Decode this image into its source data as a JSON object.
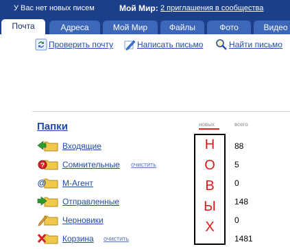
{
  "header": {
    "no_new_messages": "У Вас нет новых писем",
    "moi_mir": "Мой Мир:",
    "invites_link": "2 приглашения в сообщества"
  },
  "tabs": [
    {
      "label": "Почта",
      "active": true
    },
    {
      "label": "Адреса"
    },
    {
      "label": "Мой Мир"
    },
    {
      "label": "Файлы"
    },
    {
      "label": "Фото"
    },
    {
      "label": "Видео"
    }
  ],
  "toolbar": {
    "check_mail": "Проверить почту",
    "write_letter": "Написать письмо",
    "find_letter": "Найти письмо"
  },
  "folders": {
    "title": "Папки",
    "col_new": "новых",
    "col_total": "всего",
    "clear_label": "очистить",
    "items": [
      {
        "name": "Входящие",
        "total": "88",
        "icon": "inbox-folder-icon"
      },
      {
        "name": "Сомнительные",
        "total": "5",
        "icon": "spam-folder-icon",
        "has_clear": true
      },
      {
        "name": "М-Агент",
        "total": "0",
        "icon": "agent-folder-icon"
      },
      {
        "name": "Отправленные",
        "total": "148",
        "icon": "sent-folder-icon"
      },
      {
        "name": "Черновики",
        "total": "0",
        "icon": "drafts-folder-icon"
      },
      {
        "name": "Корзина",
        "total": "1481",
        "icon": "trash-folder-icon",
        "has_clear": true
      }
    ]
  },
  "annotation": {
    "letters": [
      "Н",
      "О",
      "В",
      "Ы",
      "Х"
    ]
  },
  "colors": {
    "header_bg": "#1c3f8a",
    "tab_bg": "#3d67b8",
    "link": "#1f4aa8",
    "annotation_red": "#e01818"
  }
}
